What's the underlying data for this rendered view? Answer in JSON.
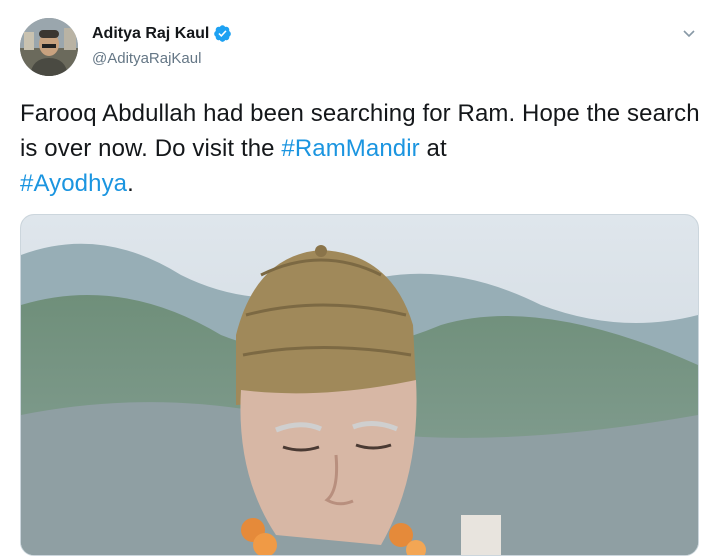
{
  "author": {
    "display_name": "Aditya Raj Kaul",
    "handle": "@AdityaRajKaul",
    "verified": true,
    "verified_icon": "verified-badge-icon"
  },
  "menu": {
    "icon": "chevron-down-icon"
  },
  "tweet": {
    "text_part1": "Farooq Abdullah had been searching for Ram. Hope the search is over now. Do visit the ",
    "hashtag1": "#RamMandir",
    "text_part2": " at ",
    "hashtag2": "#Ayodhya",
    "text_part3": "."
  },
  "colors": {
    "link": "#1b95e0",
    "handle": "#657786",
    "verified": "#1da1f2"
  }
}
